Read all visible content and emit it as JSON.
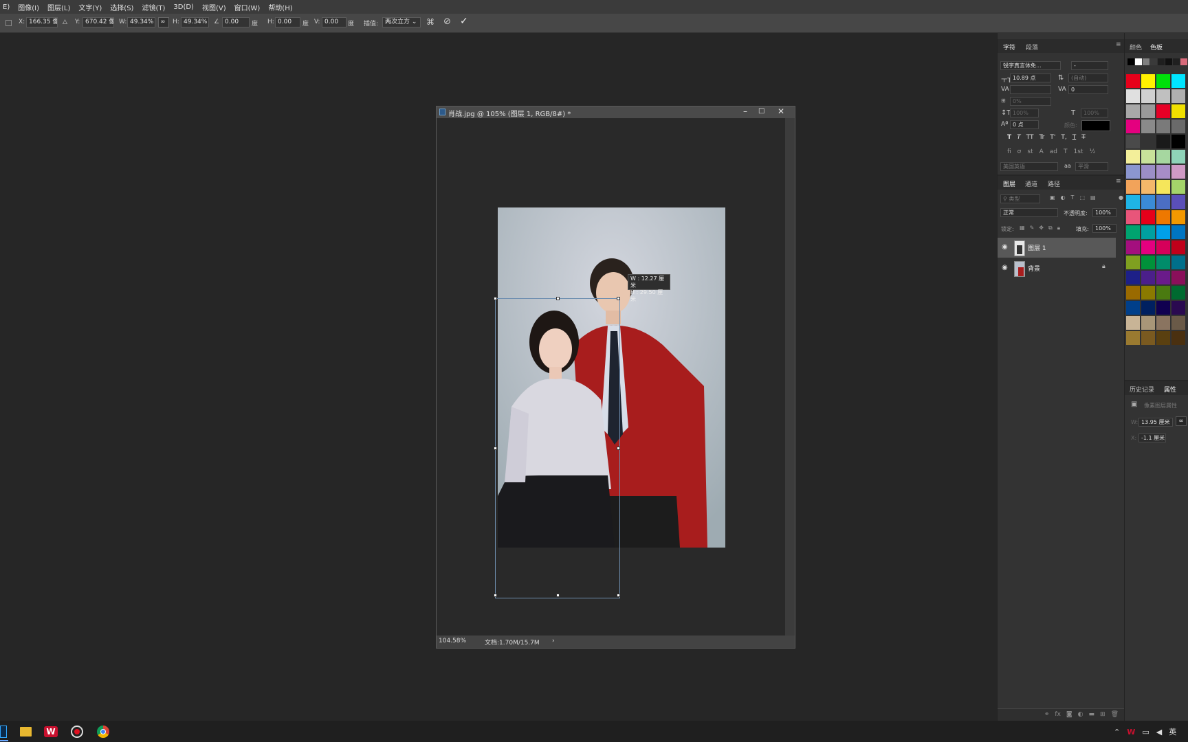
{
  "menu": [
    "E)",
    "图像(I)",
    "图层(L)",
    "文字(Y)",
    "选择(S)",
    "滤镜(T)",
    "3D(D)",
    "视图(V)",
    "窗口(W)",
    "帮助(H)"
  ],
  "options": {
    "x_label": "X:",
    "x_value": "166.35 像素",
    "y_label": "Y:",
    "y_value": "670.42 像素",
    "w_label": "W:",
    "w_value": "49.34%",
    "h_label": "H:",
    "h_value": "49.34%",
    "angle_value": "0.00",
    "angle_unit": "度",
    "hskew_label": "H:",
    "hskew_value": "0.00",
    "hskew_unit": "度",
    "vskew_label": "V:",
    "vskew_value": "0.00",
    "vskew_unit": "度",
    "interp_label": "插值:",
    "interp_value": "两次立方"
  },
  "document": {
    "title": "肖战.jpg @ 105% (图层 1, RGB/8#) *",
    "zoom": "104.58%",
    "doc_size": "文档:1.70M/15.7M",
    "tooltip_w": "W : 12.27 厘米",
    "tooltip_h": "H : 29.50 厘米"
  },
  "character_panel": {
    "tabs": [
      "字符",
      "段落"
    ],
    "font_family": "锐字真言体免...",
    "font_style": "-",
    "font_size": "10.89 点",
    "leading": "(自动)",
    "tracking": "0",
    "scale_pct": "0%",
    "vscale": "100%",
    "hscale": "100%",
    "baseline": "0 点",
    "color_label": "颜色:",
    "style_buttons": [
      "T",
      "T",
      "TT",
      "Tr",
      "T'",
      "T,",
      "T",
      "T"
    ],
    "ot_buttons": [
      "fi",
      "σ",
      "st",
      "A",
      "ad",
      "T",
      "1st",
      "½"
    ],
    "language": "美国英语",
    "aa_icon": "aa",
    "aa_mode": "平滑"
  },
  "layers_panel": {
    "tabs": [
      "图层",
      "通道",
      "路径"
    ],
    "filter_placeholder": "类型",
    "blend_mode": "正常",
    "opacity_label": "不透明度:",
    "opacity_value": "100%",
    "lock_label": "锁定:",
    "fill_label": "填充:",
    "fill_value": "100%",
    "layers": [
      {
        "name": "图层 1"
      },
      {
        "name": "背景"
      }
    ]
  },
  "swatches_panel": {
    "tabs": [
      "颜色",
      "色板"
    ],
    "colors": [
      "#e6001a",
      "#fff100",
      "#00e00a",
      "#00e5ff",
      "#e0e0e0",
      "#d0d0d0",
      "#c0c0c0",
      "#b0b0b0",
      "#a8a8a8",
      "#9a9a9a",
      "#e60026",
      "#f0e000",
      "#e4007f",
      "#8a8a8a",
      "#7a7a7a",
      "#6a6a6a",
      "#4a4a4a",
      "#333333",
      "#1a1a1a",
      "#000000",
      "#f3ef9a",
      "#c8e29a",
      "#a6d7a0",
      "#8fd3b8",
      "#8b96d0",
      "#9b8ec7",
      "#a78dc7",
      "#d09ac5",
      "#f2a35a",
      "#f4b86a",
      "#f5e65b",
      "#a4d46a",
      "#1fb4e6",
      "#3a8bd6",
      "#4b6ec4",
      "#5a4fb8",
      "#e8557a",
      "#e6001a",
      "#ee7800",
      "#f39800",
      "#00a36f",
      "#00a0a0",
      "#00a0e9",
      "#0075c2",
      "#a40f7e",
      "#e4007f",
      "#d6005a",
      "#c0001a",
      "#7fa020",
      "#00913a",
      "#008c6a",
      "#006f8a",
      "#1d2088",
      "#4b1f8a",
      "#6a1b8a",
      "#8a0f5a",
      "#9a6a00",
      "#8a7a00",
      "#4a7a10",
      "#006a30",
      "#003f8a",
      "#002060",
      "#100050",
      "#2a0a50",
      "#c8b496",
      "#a89678",
      "#8a7460",
      "#6a5a48",
      "#9a7a30",
      "#7a5a20",
      "#5a4010",
      "#4a3010"
    ]
  },
  "properties_panel": {
    "tabs": [
      "历史记录",
      "属性"
    ],
    "title": "像素图层属性",
    "w_label": "W:",
    "w_value": "13.95 厘米",
    "x_label": "X:",
    "x_value": "-1.1 厘米"
  },
  "taskbar": {
    "ime": "英"
  }
}
